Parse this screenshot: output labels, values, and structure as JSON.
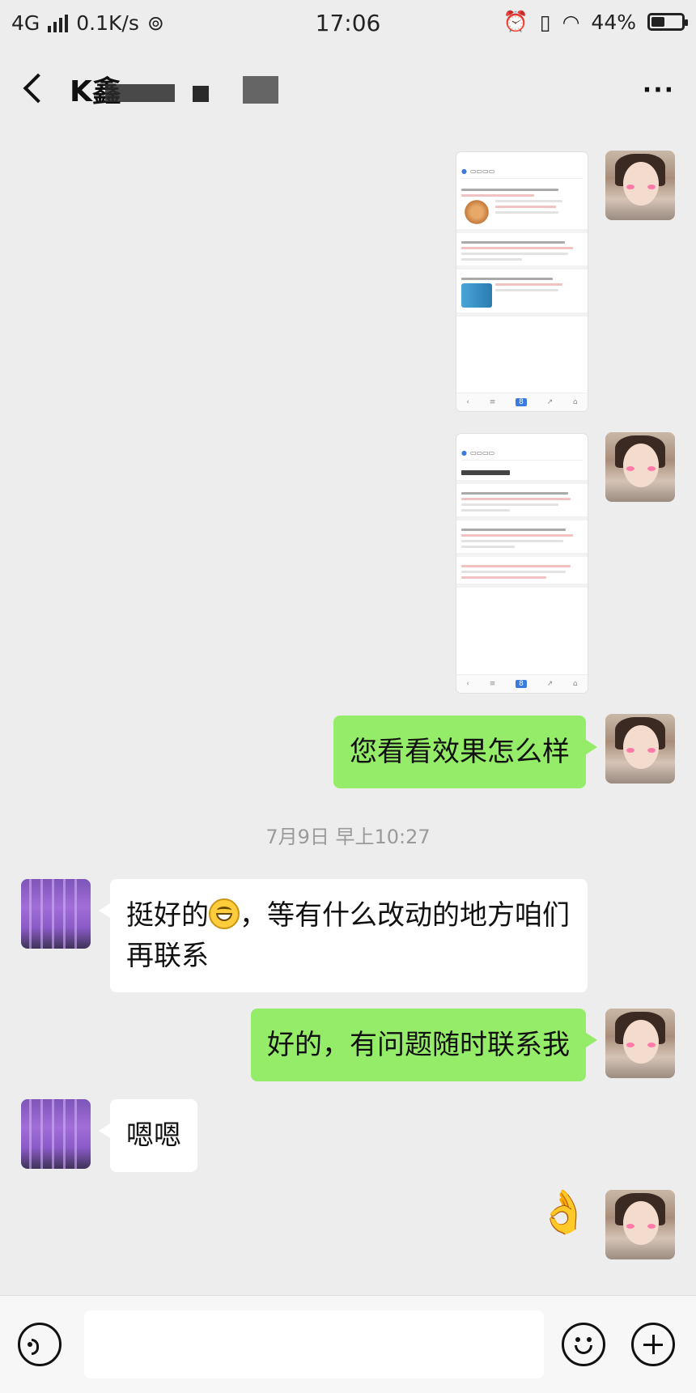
{
  "status_bar": {
    "network": "4G",
    "speed": "0.1K/s",
    "time": "17:06",
    "battery": "44%",
    "battery_level": 0.44
  },
  "nav": {
    "contact_name": "K鑫",
    "more": "···"
  },
  "messages": [
    {
      "from": "me",
      "type": "image",
      "image": "screenshot-1"
    },
    {
      "from": "me",
      "type": "image",
      "image": "screenshot-2"
    },
    {
      "from": "me",
      "type": "text",
      "text": "您看看效果怎么样"
    },
    {
      "from": "other",
      "type": "text",
      "text_before": "挺好的",
      "emoji": "grinning-emoji",
      "text_after": "，等有什么改动的地方咱们再联系"
    },
    {
      "from": "me",
      "type": "text",
      "text": "好的，有问题随时联系我"
    },
    {
      "from": "other",
      "type": "text",
      "text": "嗯嗯"
    },
    {
      "from": "me",
      "type": "emoji",
      "emoji": "👌"
    }
  ],
  "timestamp": "7月9日 早上10:27",
  "input": {
    "voice_icon": "voice-icon",
    "emoji_icon": "emoji-icon",
    "plus_icon": "plus-icon"
  },
  "colors": {
    "background": "#ededed",
    "my_bubble": "#95ec69",
    "other_bubble": "#ffffff"
  }
}
